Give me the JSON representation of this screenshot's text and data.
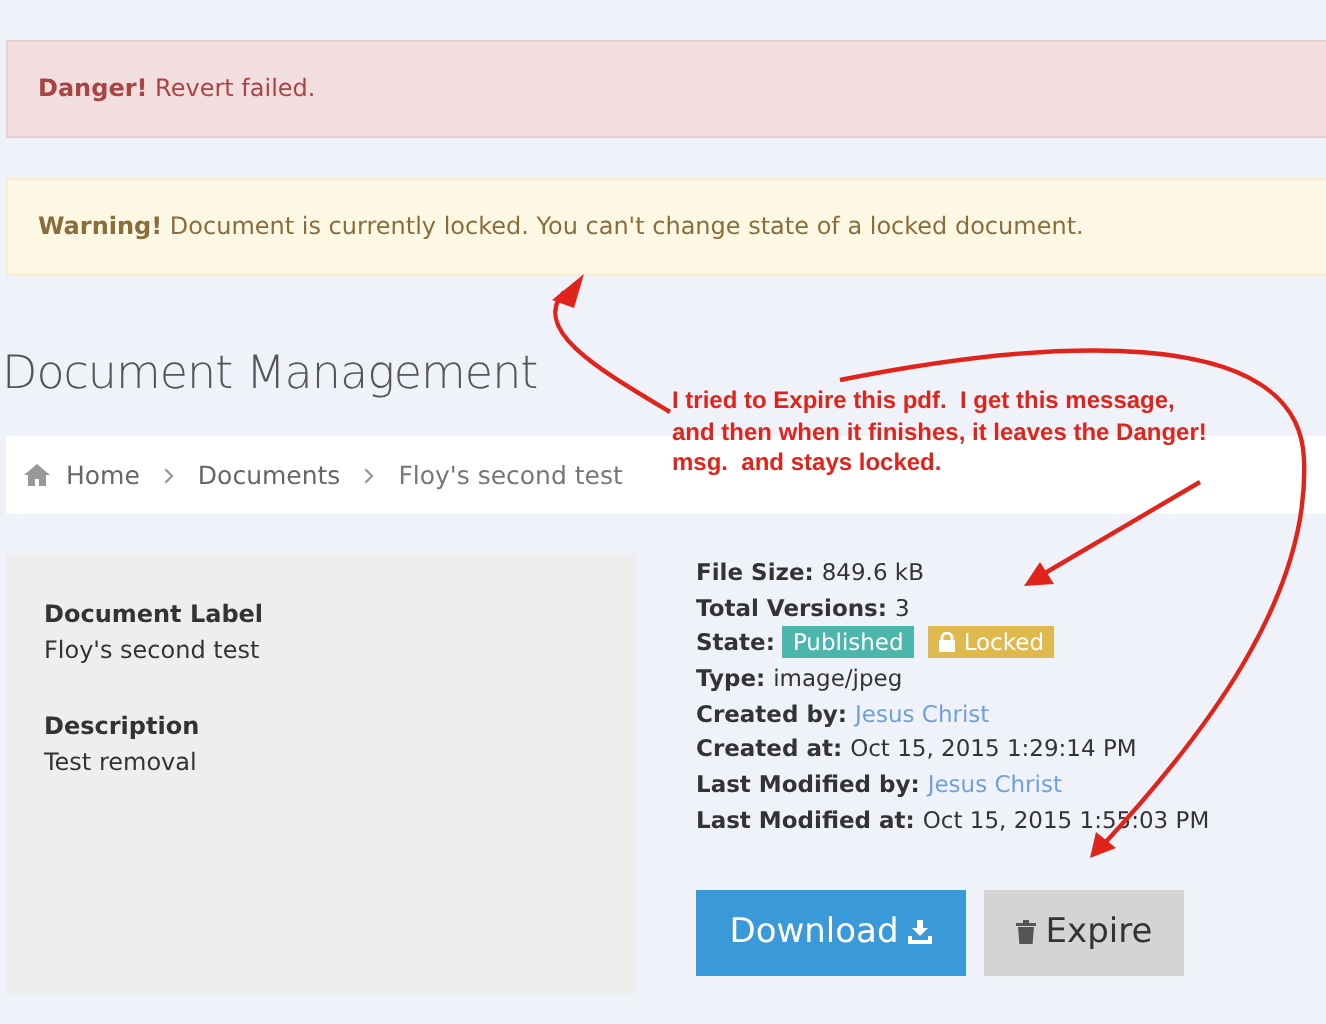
{
  "alerts": [
    {
      "kind": "danger",
      "strong": "Danger!",
      "text": "Revert failed."
    },
    {
      "kind": "warning",
      "strong": "Warning!",
      "text": "Document is currently locked. You can't change state of a locked document."
    }
  ],
  "heading": "Document Management",
  "breadcrumb": [
    {
      "label": "Home",
      "kind": "home"
    },
    {
      "label": "Documents",
      "kind": "plain"
    },
    {
      "label": "Floy's second test",
      "kind": "current"
    }
  ],
  "card": [
    {
      "label": "Document Label",
      "value": "Floy's second test"
    },
    {
      "label": "Description",
      "value": "Test removal"
    }
  ],
  "details": [
    {
      "label": "File Size:",
      "kind": "text",
      "value": "849.6 kB"
    },
    {
      "label": "Total Versions:",
      "kind": "text",
      "value": "3"
    },
    {
      "label": "State:",
      "kind": "badges",
      "badges": [
        {
          "label": "Published",
          "kind": "published"
        },
        {
          "label": "Locked",
          "kind": "locked"
        }
      ]
    },
    {
      "label": "Type:",
      "kind": "text",
      "value": "image/jpeg"
    },
    {
      "label": "Created by:",
      "kind": "link",
      "value": "Jesus Christ"
    },
    {
      "label": "Created at:",
      "kind": "text",
      "value": "Oct 15, 2015 1:29:14 PM"
    },
    {
      "label": "Last Modified by:",
      "kind": "link",
      "value": "Jesus Christ"
    },
    {
      "label": "Last Modified at:",
      "kind": "text",
      "value": "Oct 15, 2015 1:55:03 PM"
    }
  ],
  "buttons": [
    {
      "label": "Download",
      "kind": "primary"
    },
    {
      "label": "Expire",
      "kind": "default"
    }
  ],
  "annotation": {
    "note": "I tried to Expire this pdf.  I get this message, and then when it finishes, it leaves the Danger! msg.  and stays locked."
  }
}
